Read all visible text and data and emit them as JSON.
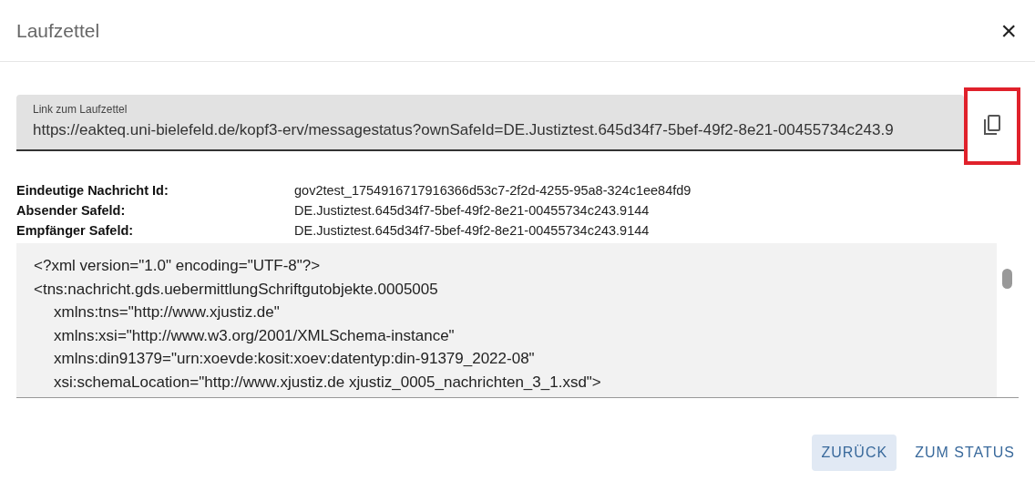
{
  "dialog": {
    "title": "Laufzettel",
    "close": "×"
  },
  "link_field": {
    "label": "Link zum Laufzettel",
    "value": "https://eakteq.uni-bielefeld.de/kopf3-erv/messagestatus?ownSafeId=DE.Justiztest.645d34f7-5bef-49f2-8e21-00455734c243.9"
  },
  "details": [
    {
      "label": "Eindeutige Nachricht Id:",
      "value": "gov2test_1754916717916366d53c7-2f2d-4255-95a8-324c1ee84fd9"
    },
    {
      "label": "Absender Safeld:",
      "value": "DE.Justiztest.645d34f7-5bef-49f2-8e21-00455734c243.9144"
    },
    {
      "label": "Empfänger Safeld:",
      "value": "DE.Justiztest.645d34f7-5bef-49f2-8e21-00455734c243.9144"
    }
  ],
  "xml_lines": [
    {
      "text": "<?xml version=\"1.0\" encoding=\"UTF-8\"?>",
      "indent": false
    },
    {
      "text": "<tns:nachricht.gds.uebermittlungSchriftgutobjekte.0005005",
      "indent": false
    },
    {
      "text": "xmlns:tns=\"http://www.xjustiz.de\"",
      "indent": true
    },
    {
      "text": "xmlns:xsi=\"http://www.w3.org/2001/XMLSchema-instance\"",
      "indent": true
    },
    {
      "text": "xmlns:din91379=\"urn:xoevde:kosit:xoev:datentyp:din-91379_2022-08\"",
      "indent": true
    },
    {
      "text": "xsi:schemaLocation=\"http://www.xjustiz.de xjustiz_0005_nachrichten_3_1.xsd\">",
      "indent": true
    }
  ],
  "buttons": [
    {
      "label": "ZURÜCK",
      "selected": true
    },
    {
      "label": "ZUM STATUS",
      "selected": false
    }
  ]
}
